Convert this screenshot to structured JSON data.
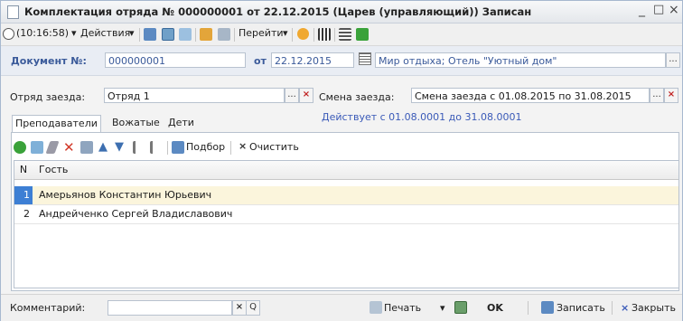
{
  "window": {
    "title": "Комплектация отряда № 000000001 от 22.12.2015 (Царев (управляющий)) Записан",
    "min_glyph": "_",
    "max_glyph": "□",
    "close_glyph": "×"
  },
  "toolbar": {
    "time_label": "(10:16:58)",
    "actions_label": "Действия",
    "goto_label": "Перейти",
    "dropdown_glyph": "▾"
  },
  "doc": {
    "number_label": "Документ №:",
    "number_value": "000000001",
    "date_label": "от",
    "date_value": "22.12.2015",
    "place_value": "Мир отдыха; Отель \"Уютный дом\"",
    "place_btn": "..."
  },
  "fields": {
    "squad_label": "Отряд заезда:",
    "squad_value": "Отряд 1",
    "squad_btn": "...",
    "clear_btn": "×",
    "shift_label": "Смена заезда:",
    "shift_value": "Смена заезда с 01.08.2015 по 31.08.2015",
    "shift_btn": "...",
    "notice": "Действует с 01.08.0001 до 31.08.0001"
  },
  "tabs": [
    {
      "label": "Преподаватели"
    },
    {
      "label": "Вожатые"
    },
    {
      "label": "Дети"
    }
  ],
  "subtoolbar": {
    "select_label": "Подбор",
    "clear_label": "Очистить",
    "clear_glyph": "×"
  },
  "table": {
    "columns": [
      "N",
      "Гость"
    ],
    "rows": [
      {
        "n": "1",
        "name": "Амерьянов Константин Юрьевич"
      },
      {
        "n": "2",
        "name": "Андрейченко Сергей Владиславович"
      }
    ]
  },
  "footer": {
    "comment_label": "Комментарий:",
    "comment_value": "",
    "print_label": "Печать",
    "ok_label": "OK",
    "save_label": "Записать",
    "close_label": "Закрыть",
    "clear_glyph": "×",
    "search_glyph": "Q",
    "dropdown_glyph": "▾"
  },
  "colors": {
    "accent_blue": "#3a5a9a",
    "row_select": "#3d7fd4",
    "add_green": "#3aa23a",
    "delete_red": "#d23a2a"
  }
}
